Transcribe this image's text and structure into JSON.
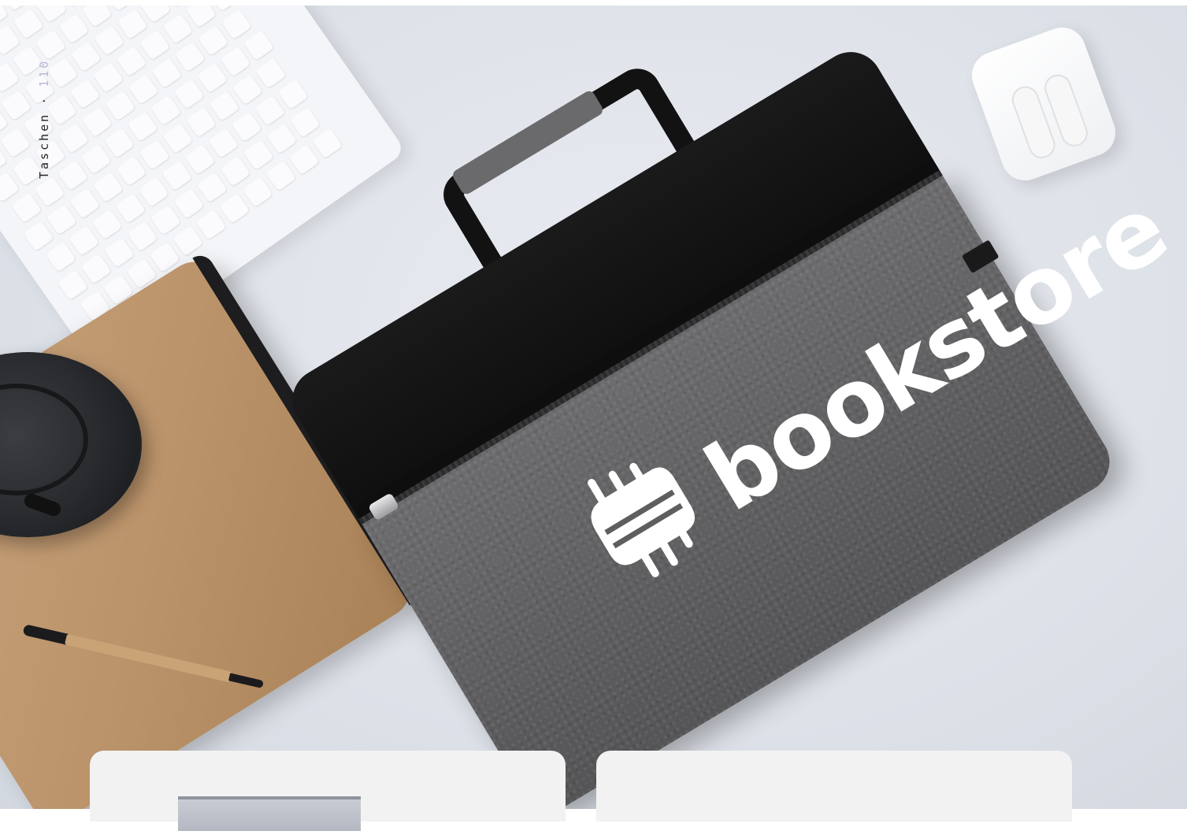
{
  "section": {
    "category": "Taschen",
    "separator": "·",
    "page_number": "110"
  },
  "hero_image": {
    "logo_text": "bookstore",
    "logo_icon": "bookstore-logo-icon"
  },
  "colors": {
    "background": "#dde1e8",
    "bag_felt": "#5e5e60",
    "bag_top": "#121213",
    "cork": "#bb936a",
    "page_number": "#b8b9d6",
    "card": "#f2f2f2"
  },
  "cards": [
    {
      "name": "product-card-left"
    },
    {
      "name": "product-card-right"
    }
  ]
}
